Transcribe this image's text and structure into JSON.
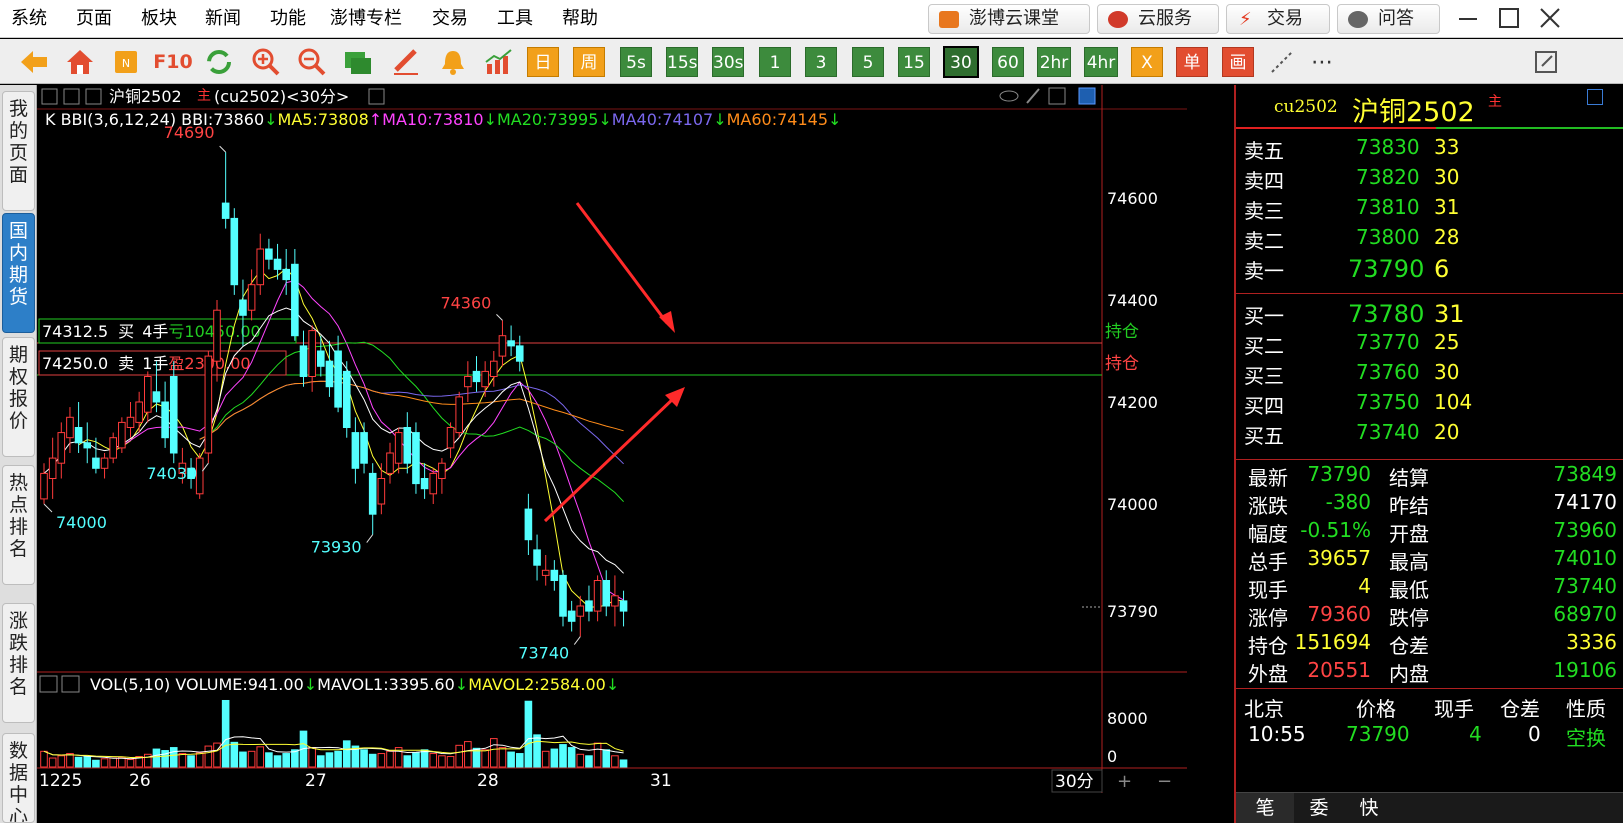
{
  "menu": [
    "系统",
    "页面",
    "板块",
    "新闻",
    "功能",
    "澎博专栏",
    "交易",
    "工具",
    "帮助"
  ],
  "top_buttons": [
    {
      "label": "澎博云课堂",
      "color": "#e8771e"
    },
    {
      "label": "云服务",
      "color": "#d13a2a"
    },
    {
      "label": "交易",
      "color": "#e33b22"
    },
    {
      "label": "问答",
      "color": "#555555"
    }
  ],
  "toolbar": {
    "icons": [
      "back-arrow-icon",
      "home-icon",
      "news-icon",
      "f10-icon",
      "refresh-icon",
      "zoom-in-icon",
      "zoom-out-icon",
      "window-icon",
      "draw-pen-icon",
      "alarm-bell-icon",
      "trend-chart-icon"
    ],
    "f10_label": "F10",
    "periods": [
      "日",
      "周",
      "5s",
      "15s",
      "30s",
      "1",
      "3",
      "5",
      "15",
      "30",
      "60",
      "2hr",
      "4hr"
    ],
    "selected_period": "30",
    "extra": [
      "X",
      "单",
      "画"
    ],
    "more": "⋯"
  },
  "left_tabs": [
    "我的页面",
    "国内期货",
    "期权报价",
    "热点排名",
    "涨跌排名",
    "数据中心"
  ],
  "left_tab_active": "国内期货",
  "chart_header": {
    "symbol": "沪铜2502",
    "badge": "主",
    "code_period": "(cu2502)<30分>",
    "indicator_prefix": "K BBI(3,6,12,24) BBI:73860",
    "ma5": "MA5:73808",
    "ma10": "MA10:73810",
    "ma20": "MA20:73995",
    "ma40": "MA40:74107",
    "ma60": "MA60:74145",
    "arrow_down": "↓",
    "arrow_up": "↑"
  },
  "positions": [
    {
      "price": "74312.5",
      "side": "买",
      "qty": "4手",
      "pl_label": "亏",
      "pl_value": "10450.00",
      "tag": "持仓"
    },
    {
      "price": "74250.0",
      "side": "卖",
      "qty": "1手",
      "pl_label": "盈",
      "pl_value": "2300.00",
      "tag": "持仓"
    }
  ],
  "price_annotations": [
    "74690",
    "74360",
    "74000",
    "74030",
    "73930",
    "73740"
  ],
  "vol_header": {
    "prefix": "VOL(5,10) VOLUME:941.00",
    "mavol1": "MAVOL1:3395.60",
    "mavol2": "MAVOL2:2584.00",
    "arrow_down": "↓"
  },
  "vol_axis": [
    "8000",
    "0"
  ],
  "date_labels": [
    "1225",
    "26",
    "27",
    "28",
    "31"
  ],
  "period_label": "30分",
  "zoom_plus": "+",
  "zoom_minus": "−",
  "chart_data": {
    "type": "candlestick",
    "y_ticks": [
      74600,
      74400,
      74200,
      74000
    ],
    "current_price": 73790,
    "ylim": [
      73690,
      74790
    ],
    "vol_ylim": [
      0,
      9500
    ],
    "candles": [
      [
        74010,
        74080,
        74000,
        74060
      ],
      [
        74050,
        74130,
        74010,
        74090
      ],
      [
        74080,
        74160,
        74050,
        74140
      ],
      [
        74130,
        74190,
        74100,
        74170
      ],
      [
        74150,
        74200,
        74100,
        74120
      ],
      [
        74120,
        74160,
        74080,
        74110
      ],
      [
        74090,
        74130,
        74060,
        74070
      ],
      [
        74070,
        74100,
        74050,
        74090
      ],
      [
        74090,
        74140,
        74080,
        74130
      ],
      [
        74110,
        74170,
        74100,
        74160
      ],
      [
        74150,
        74200,
        74130,
        74170
      ],
      [
        74160,
        74220,
        74140,
        74200
      ],
      [
        74180,
        74260,
        74160,
        74250
      ],
      [
        74220,
        74280,
        74180,
        74200
      ],
      [
        74200,
        74240,
        74110,
        74130
      ],
      [
        74250,
        74280,
        74080,
        74100
      ],
      [
        74060,
        74110,
        74040,
        74080
      ],
      [
        74070,
        74090,
        74030,
        74050
      ],
      [
        74020,
        74100,
        74010,
        74090
      ],
      [
        74100,
        74300,
        74080,
        74290
      ],
      [
        74280,
        74400,
        74240,
        74380
      ],
      [
        74590,
        74690,
        74540,
        74560
      ],
      [
        74560,
        74580,
        74410,
        74430
      ],
      [
        74400,
        74440,
        74310,
        74370
      ],
      [
        74380,
        74460,
        74360,
        74430
      ],
      [
        74430,
        74530,
        74410,
        74500
      ],
      [
        74500,
        74520,
        74460,
        74480
      ],
      [
        74480,
        74510,
        74440,
        74460
      ],
      [
        74460,
        74500,
        74410,
        74440
      ],
      [
        74470,
        74500,
        74320,
        74330
      ],
      [
        74310,
        74340,
        74230,
        74250
      ],
      [
        74250,
        74350,
        74220,
        74340
      ],
      [
        74300,
        74330,
        74250,
        74270
      ],
      [
        74280,
        74320,
        74210,
        74230
      ],
      [
        74300,
        74330,
        74180,
        74190
      ],
      [
        74260,
        74280,
        74130,
        74150
      ],
      [
        74140,
        74170,
        74040,
        74070
      ],
      [
        74140,
        74160,
        74060,
        74080
      ],
      [
        74060,
        74080,
        73940,
        73980
      ],
      [
        74000,
        74080,
        73980,
        74050
      ],
      [
        74060,
        74120,
        74040,
        74100
      ],
      [
        74080,
        74150,
        74060,
        74140
      ],
      [
        74150,
        74180,
        74060,
        74080
      ],
      [
        74140,
        74160,
        74020,
        74040
      ],
      [
        74050,
        74080,
        74010,
        74030
      ],
      [
        74020,
        74070,
        74000,
        74060
      ],
      [
        74050,
        74090,
        74020,
        74080
      ],
      [
        74110,
        74160,
        74090,
        74150
      ],
      [
        74140,
        74220,
        74130,
        74210
      ],
      [
        74230,
        74280,
        74200,
        74250
      ],
      [
        74260,
        74290,
        74220,
        74240
      ],
      [
        74230,
        74280,
        74210,
        74260
      ],
      [
        74250,
        74300,
        74230,
        74280
      ],
      [
        74290,
        74360,
        74270,
        74330
      ],
      [
        74320,
        74350,
        74290,
        74310
      ],
      [
        74310,
        74330,
        74260,
        74280
      ],
      [
        73990,
        74020,
        73900,
        73930
      ],
      [
        73910,
        73940,
        73850,
        73880
      ],
      [
        73860,
        73900,
        73840,
        73870
      ],
      [
        73870,
        73890,
        73830,
        73850
      ],
      [
        73860,
        73870,
        73760,
        73780
      ],
      [
        73790,
        73810,
        73750,
        73770
      ],
      [
        73780,
        73820,
        73740,
        73800
      ],
      [
        73810,
        73840,
        73770,
        73790
      ],
      [
        73790,
        73860,
        73770,
        73850
      ],
      [
        73850,
        73870,
        73780,
        73800
      ],
      [
        73800,
        73860,
        73760,
        73820
      ],
      [
        73810,
        73830,
        73760,
        73790
      ]
    ],
    "volumes": [
      2100,
      1200,
      1500,
      1800,
      1300,
      1400,
      900,
      1100,
      1200,
      1300,
      1000,
      1400,
      1700,
      2400,
      2200,
      2600,
      1800,
      1500,
      1900,
      2800,
      3200,
      8900,
      3300,
      2000,
      2100,
      2700,
      1900,
      1500,
      1800,
      2300,
      4800,
      2600,
      1500,
      1900,
      2100,
      3500,
      2800,
      2300,
      1700,
      1800,
      2100,
      2600,
      1500,
      1900,
      2300,
      1800,
      1500,
      1400,
      2900,
      3400,
      2500,
      2300,
      3800,
      2600,
      2000,
      1800,
      8800,
      4300,
      2100,
      2400,
      3000,
      2600,
      1700,
      1500,
      3200,
      2300,
      1500,
      941
    ]
  },
  "quote": {
    "code": "cu2502",
    "name": "沪铜2502",
    "badge": "主",
    "asks": [
      {
        "label": "卖五",
        "price": "73830",
        "vol": "33"
      },
      {
        "label": "卖四",
        "price": "73820",
        "vol": "30"
      },
      {
        "label": "卖三",
        "price": "73810",
        "vol": "31"
      },
      {
        "label": "卖二",
        "price": "73800",
        "vol": "28"
      },
      {
        "label": "卖一",
        "price": "73790",
        "vol": "6"
      }
    ],
    "bids": [
      {
        "label": "买一",
        "price": "73780",
        "vol": "31"
      },
      {
        "label": "买二",
        "price": "73770",
        "vol": "25"
      },
      {
        "label": "买三",
        "price": "73760",
        "vol": "30"
      },
      {
        "label": "买四",
        "price": "73750",
        "vol": "104"
      },
      {
        "label": "买五",
        "price": "73740",
        "vol": "20"
      }
    ],
    "stats": [
      {
        "l1": "最新",
        "v1": "73790",
        "c1": "#22dd22",
        "l2": "结算",
        "v2": "73849",
        "c2": "#22dd22"
      },
      {
        "l1": "涨跌",
        "v1": "-380",
        "c1": "#22dd22",
        "l2": "昨结",
        "v2": "74170",
        "c2": "#ffffff"
      },
      {
        "l1": "幅度",
        "v1": "-0.51%",
        "c1": "#22dd22",
        "l2": "开盘",
        "v2": "73960",
        "c2": "#22dd22"
      },
      {
        "l1": "总手",
        "v1": "39657",
        "c1": "#ffff33",
        "l2": "最高",
        "v2": "74010",
        "c2": "#22dd22"
      },
      {
        "l1": "现手",
        "v1": "4",
        "c1": "#ffff33",
        "l2": "最低",
        "v2": "73740",
        "c2": "#22dd22"
      },
      {
        "l1": "涨停",
        "v1": "79360",
        "c1": "#ff4444",
        "l2": "跌停",
        "v2": "68970",
        "c2": "#22dd22"
      },
      {
        "l1": "持仓",
        "v1": "151694",
        "c1": "#ffff33",
        "l2": "仓差",
        "v2": "3336",
        "c2": "#ffff33"
      },
      {
        "l1": "外盘",
        "v1": "20551",
        "c1": "#ff4444",
        "l2": "内盘",
        "v2": "19106",
        "c2": "#22dd22"
      }
    ],
    "tick_headers": [
      "北京",
      "价格",
      "现手",
      "仓差",
      "性质"
    ],
    "tick": {
      "time": "10:55",
      "price": "73790",
      "vol": "4",
      "oi": "0",
      "nature": "空换"
    },
    "bottom_tabs": [
      "笔",
      "委",
      "快"
    ]
  }
}
